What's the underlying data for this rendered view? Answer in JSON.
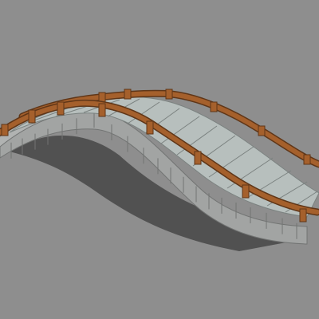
{
  "colors": {
    "background": "#8e8e8e",
    "shadow": "#515151",
    "deck": "#b7bfbd",
    "deck_plank_line": "#7b8280",
    "stone_face": "#a2a4a3",
    "stone_face_light": "#b1b3b2",
    "stone_joint": "#727473",
    "wood": "#a5602c",
    "wood_dark": "#5f3618",
    "wood_light": "#c07a3e"
  }
}
